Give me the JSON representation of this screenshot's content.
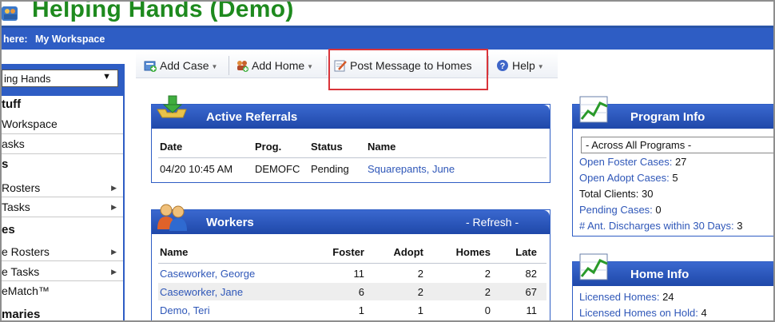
{
  "header": {
    "title": "Helping Hands (Demo)"
  },
  "breadcrumb": {
    "label": "here:",
    "value": "My Workspace"
  },
  "sidebar": {
    "agency_select": "ing Hands",
    "items": [
      {
        "label": "tuff",
        "type": "head"
      },
      {
        "label": "Workspace",
        "type": "item"
      },
      {
        "label": "asks",
        "type": "item"
      },
      {
        "label": "s",
        "type": "head"
      },
      {
        "label": "Rosters",
        "type": "item",
        "submenu": true
      },
      {
        "label": "Tasks",
        "type": "item",
        "submenu": true
      },
      {
        "label": "es",
        "type": "head"
      },
      {
        "label": "e Rosters",
        "type": "item",
        "submenu": true
      },
      {
        "label": "e Tasks",
        "type": "item",
        "submenu": true
      },
      {
        "label": "eMatch™",
        "type": "item"
      },
      {
        "label": "maries",
        "type": "head"
      }
    ]
  },
  "toolbar": {
    "add_case": "Add Case",
    "add_home": "Add Home",
    "post_message": "Post Message to Homes",
    "help": "Help",
    "icons": [
      "add-case-icon",
      "add-home-icon",
      "post-message-icon",
      "help-icon"
    ]
  },
  "referrals": {
    "title": "Active Referrals",
    "columns": [
      "Date",
      "Prog.",
      "Status",
      "Name"
    ],
    "rows": [
      {
        "date": "04/20 10:45 AM",
        "prog": "DEMOFC",
        "status": "Pending",
        "name": "Squarepants, June"
      }
    ]
  },
  "workers": {
    "title": "Workers",
    "refresh": "- Refresh -",
    "columns": [
      "Name",
      "Foster",
      "Adopt",
      "Homes",
      "Late"
    ],
    "rows": [
      {
        "name": "Caseworker, George",
        "foster": "11",
        "adopt": "2",
        "homes": "2",
        "late": "82"
      },
      {
        "name": "Caseworker, Jane",
        "foster": "6",
        "adopt": "2",
        "homes": "2",
        "late": "67"
      },
      {
        "name": "Demo, Teri",
        "foster": "1",
        "adopt": "1",
        "homes": "0",
        "late": "11"
      }
    ]
  },
  "program_info": {
    "title": "Program Info",
    "select": "- Across All Programs -",
    "lines": [
      {
        "label": "Open Foster Cases:",
        "value": "27",
        "link": true
      },
      {
        "label": "Open Adopt Cases:",
        "value": "5",
        "link": true
      },
      {
        "label": "Total Clients:",
        "value": "30",
        "link": false
      },
      {
        "label": "Pending Cases:",
        "value": "0",
        "link": true
      },
      {
        "label": "# Ant. Discharges within 30 Days:",
        "value": "3",
        "link": true
      }
    ]
  },
  "home_info": {
    "title": "Home Info",
    "lines": [
      {
        "label": "Licensed Homes:",
        "value": "24"
      },
      {
        "label": "Licensed Homes on Hold:",
        "value": "4"
      }
    ]
  },
  "colors": {
    "brand_green": "#1e8a1e",
    "bar_blue": "#2e5dc4",
    "link_blue": "#2f57b8",
    "highlight_red": "#d9343a"
  }
}
